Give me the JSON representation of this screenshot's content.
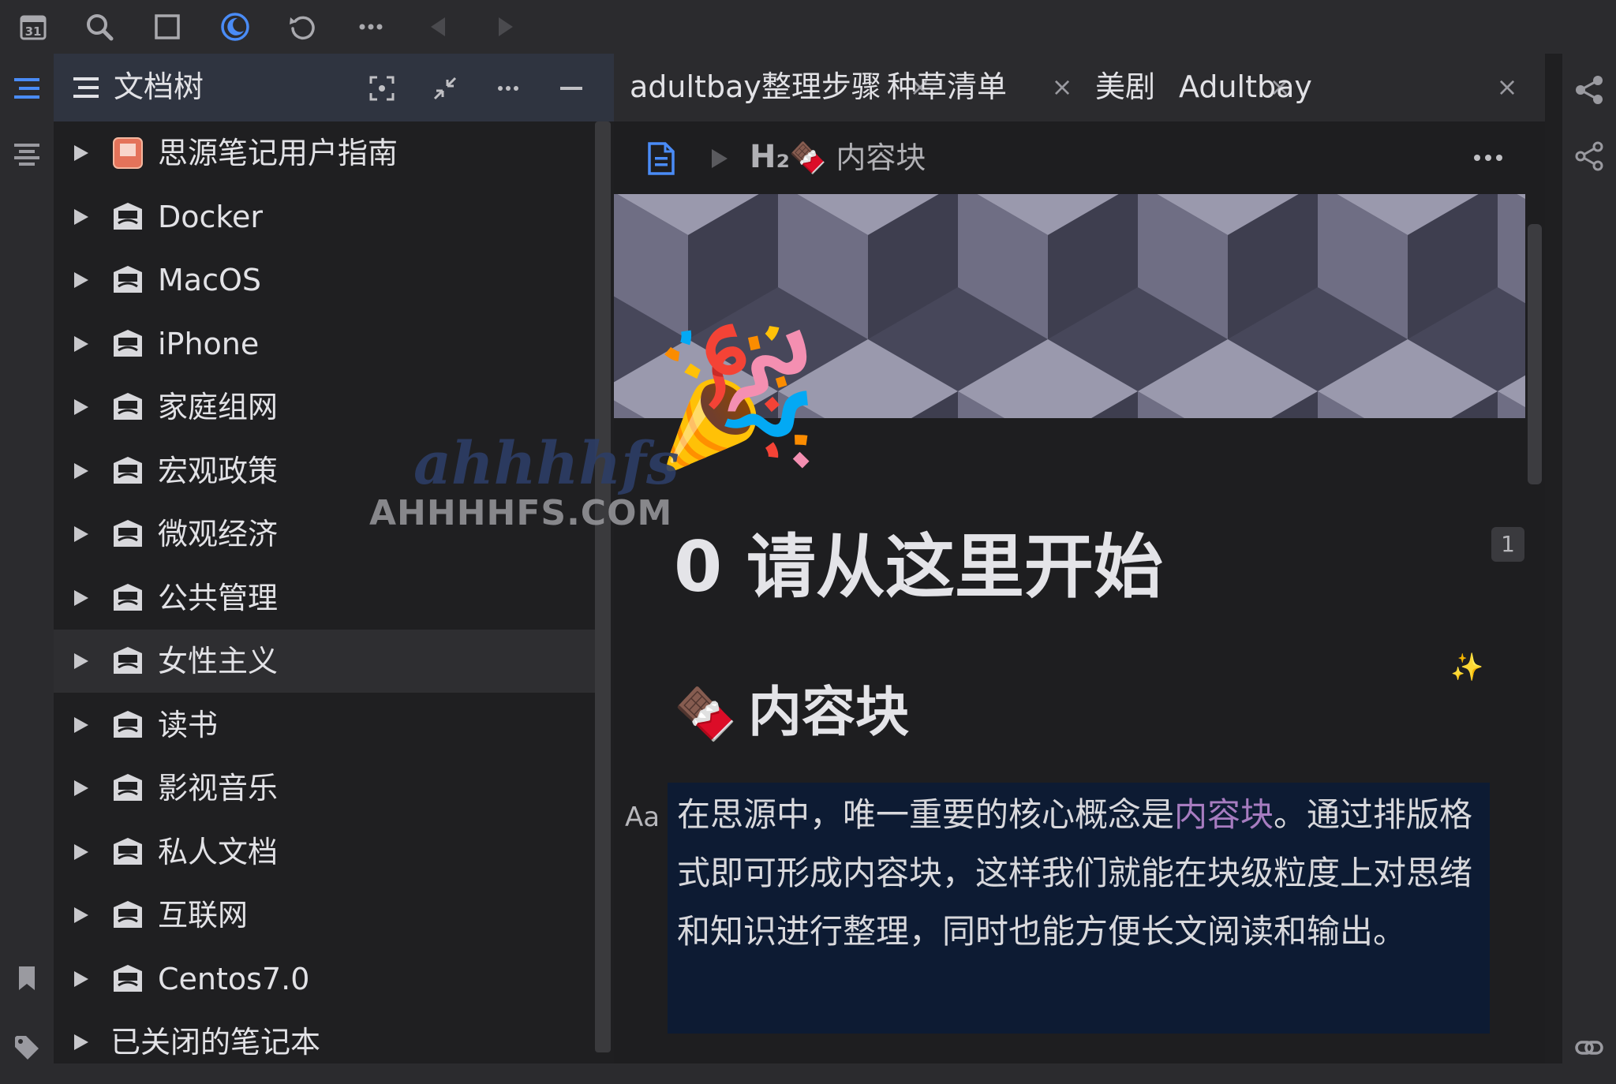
{
  "toolbar": {
    "calendar_day": "31"
  },
  "tree": {
    "title": "文档树",
    "items": [
      {
        "label": "思源笔记用户指南",
        "selected": false
      },
      {
        "label": "Docker",
        "selected": false
      },
      {
        "label": "MacOS",
        "selected": false
      },
      {
        "label": "iPhone",
        "selected": false
      },
      {
        "label": "家庭组网",
        "selected": false
      },
      {
        "label": "宏观政策",
        "selected": false
      },
      {
        "label": "微观经济",
        "selected": false
      },
      {
        "label": "公共管理",
        "selected": false
      },
      {
        "label": "女性主义",
        "selected": true
      },
      {
        "label": "读书",
        "selected": false
      },
      {
        "label": "影视音乐",
        "selected": false
      },
      {
        "label": "私人文档",
        "selected": false
      },
      {
        "label": "互联网",
        "selected": false
      },
      {
        "label": "Centos7.0",
        "selected": false
      }
    ],
    "closed_notebooks": "已关闭的笔记本"
  },
  "tabs": [
    {
      "label": "adultbay整理步骤",
      "close": "×"
    },
    {
      "label": "种草清单",
      "close": "×"
    },
    {
      "label": "美剧",
      "close": "×"
    },
    {
      "label": "Adultbay",
      "close": "×"
    }
  ],
  "breadcrumb": {
    "heading_tag": "H₂",
    "label": "🍫 内容块"
  },
  "editor": {
    "doc_icon": "🎉",
    "title": "0 请从这里开始",
    "sparkle": "✨",
    "backlink_count": "1",
    "heading_icon": "🍫",
    "heading": "内容块",
    "block_type_label": "Aa",
    "paragraph_before": "在思源中，唯一重要的核心概念是",
    "paragraph_ref": "内容块",
    "paragraph_after": "。通过排版格式即可形成内容块，这样我们就能在块级粒度上对思绪和知识进行整理，同时也能方便长文阅读和输出。"
  },
  "watermark": {
    "script": "ahhhhfs",
    "domain": "AHHHHFS.COM"
  },
  "colors": {
    "accent": "#4a8cf7",
    "ref_link": "#a77cc0",
    "paragraph_bg": "#0d1b33",
    "tree_header_bg": "#2f3440"
  }
}
